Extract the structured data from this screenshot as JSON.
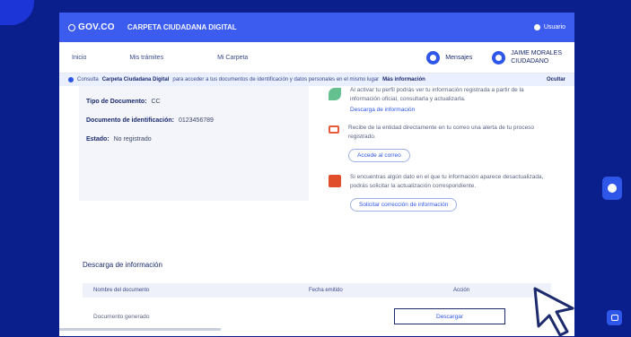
{
  "topbar": {
    "brand": "GOV.CO",
    "portal_title": "CARPETA CIUDADANA DIGITAL",
    "user_chip": "Usuario"
  },
  "nav": {
    "items": [
      "Inicio",
      "Mis trámites",
      "Mi Carpeta"
    ],
    "notifications_label": "Mensajes",
    "user_line1": "JAIME MORALES",
    "user_line2": "CIUDADANO"
  },
  "alert": {
    "prefix": "Consulta",
    "highlight": "Carpeta Ciudadana Digital",
    "text": "para acceder a tus documentos de identificación y datos personales en el mismo lugar",
    "link": "Más información",
    "action": "Ocultar"
  },
  "profile": {
    "doc_type_label": "Tipo de Documento:",
    "doc_type_value": "CC",
    "doc_id_label": "Documento de identificación:",
    "doc_id_value": "0123456789",
    "status_label": "Estado:",
    "status_value": "No registrado"
  },
  "info_blocks": {
    "block1_text": "Al activar tu perfil podrás ver tu información registrada a partir de la información oficial, consultarla y actualizarla.",
    "block1_link": "Descarga de información",
    "block2_text": "Recibe de la entidad directamente en tu correo una alerta de tu proceso registrado.",
    "block2_button": "Accede al correo",
    "block3_text": "Si encuentras algún dato en el que tu información aparece desactualizada, podrás solicitar la actualización correspondiente.",
    "block3_button": "Solicitar corrección de información"
  },
  "downloads": {
    "title": "Descarga de información",
    "col_name": "Nombre del documento",
    "col_date": "Fecha emitido",
    "col_action": "Acción",
    "row_name": "Documento generado",
    "row_action": "Descargar"
  },
  "icons": {
    "info_leaf": "leaf-icon",
    "info_laptop": "laptop-icon",
    "info_message": "message-icon",
    "floating": "accessibility-icon",
    "chat": "chat-icon"
  },
  "colors": {
    "background": "#0b1f8c",
    "topbar": "#3c5cf0",
    "accent": "#2e56e8"
  }
}
